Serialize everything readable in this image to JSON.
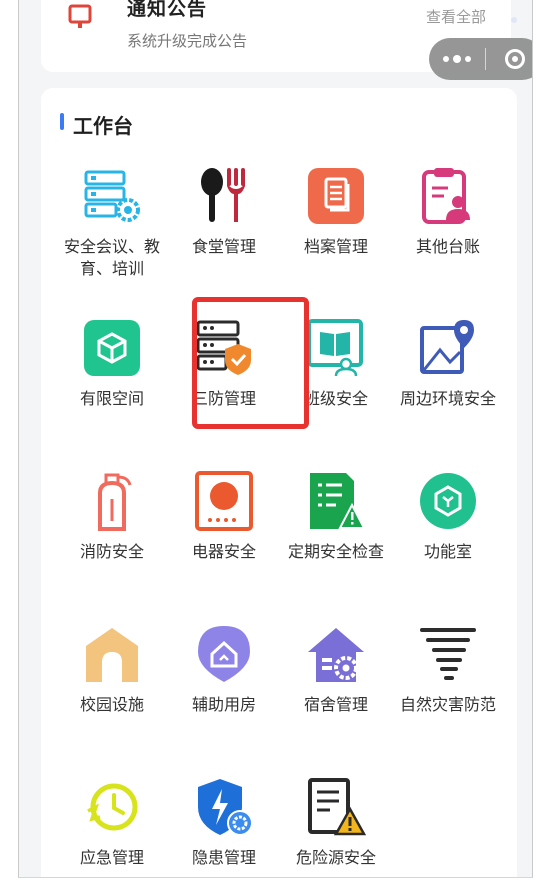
{
  "notice": {
    "title": "通知公告",
    "subtitle": "系统升级完成公告",
    "more": "查看全部"
  },
  "capsule": {
    "more_icon": "more-dots-icon",
    "close_icon": "target-icon"
  },
  "workbench": {
    "title": "工作台",
    "items": [
      {
        "label": "安全会议、教育、培训",
        "icon": "server-gear-icon"
      },
      {
        "label": "食堂管理",
        "icon": "spoon-fork-icon"
      },
      {
        "label": "档案管理",
        "icon": "document-icon"
      },
      {
        "label": "其他台账",
        "icon": "clipboard-user-icon"
      },
      {
        "label": "有限空间",
        "icon": "cube-icon"
      },
      {
        "label": "三防管理",
        "icon": "server-shield-icon"
      },
      {
        "label": "班级安全",
        "icon": "book-user-icon"
      },
      {
        "label": "周边环境安全",
        "icon": "map-pin-icon"
      },
      {
        "label": "消防安全",
        "icon": "extinguisher-icon"
      },
      {
        "label": "电器安全",
        "icon": "stove-icon"
      },
      {
        "label": "定期安全检查",
        "icon": "checklist-warning-icon"
      },
      {
        "label": "功能室",
        "icon": "hexagon-icon"
      },
      {
        "label": "校园设施",
        "icon": "school-gate-icon"
      },
      {
        "label": "辅助用房",
        "icon": "house-pin-icon"
      },
      {
        "label": "宿舍管理",
        "icon": "house-gear-icon"
      },
      {
        "label": "自然灾害防范",
        "icon": "tornado-icon"
      },
      {
        "label": "应急管理",
        "icon": "alarm-clock-icon"
      },
      {
        "label": "隐患管理",
        "icon": "shield-bolt-icon"
      },
      {
        "label": "危险源安全",
        "icon": "document-warning-icon"
      }
    ]
  },
  "colors": {
    "accent": "#3b7cf5",
    "highlight": "#e8322f"
  }
}
